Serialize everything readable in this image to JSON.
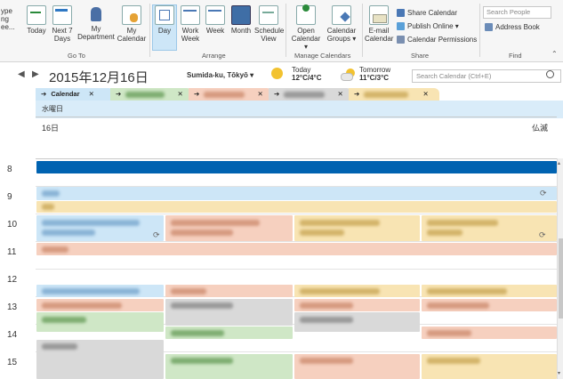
{
  "ribbon": {
    "partial_left": [
      "ype",
      "ng",
      "ee..."
    ],
    "goto": {
      "today": "Today",
      "next7_l1": "Next 7",
      "next7_l2": "Days",
      "dept_l1": "My",
      "dept_l2": "Department",
      "mycal_l1": "My",
      "mycal_l2": "Calendar",
      "group_label": "Go To"
    },
    "arrange": {
      "day": "Day",
      "workweek_l1": "Work",
      "workweek_l2": "Week",
      "week": "Week",
      "month": "Month",
      "schedule_l1": "Schedule",
      "schedule_l2": "View",
      "group_label": "Arrange"
    },
    "manage": {
      "open_l1": "Open",
      "open_l2": "Calendar ▾",
      "groups_l1": "Calendar",
      "groups_l2": "Groups ▾",
      "group_label": "Manage Calendars"
    },
    "share": {
      "email_l1": "E-mail",
      "email_l2": "Calendar",
      "share_calendar": "Share Calendar",
      "publish_online": "Publish Online ▾",
      "permissions": "Calendar Permissions",
      "group_label": "Share"
    },
    "find": {
      "search_people_placeholder": "Search People",
      "address_book": "Address Book",
      "group_label": "Find"
    }
  },
  "nav": {
    "date_title": "2015年12月16日",
    "location": "Sumida-ku, Tōkyō ▾",
    "today_label": "Today",
    "today_temp": "12°C/4°C",
    "tomorrow_label": "Tomorrow",
    "tomorrow_temp": "11°C/3°C",
    "search_placeholder": "Search Calendar (Ctrl+E)"
  },
  "tabs": [
    {
      "label": "Calendar",
      "color": "#cde6f7"
    },
    {
      "label": "",
      "color": "#cfe7c6"
    },
    {
      "label": "",
      "color": "#f6d0bf"
    },
    {
      "label": "",
      "color": "#d9d9d9"
    },
    {
      "label": "",
      "color": "#f8e4b3"
    }
  ],
  "day": {
    "weekday": "水曜日",
    "date": "16日",
    "rokuyo": "仏滅"
  },
  "hours": [
    "8",
    "9",
    "10",
    "11",
    "12",
    "13",
    "14",
    "15"
  ],
  "colors": {
    "accent": "#0063b1",
    "blue": "#cde6f7",
    "green": "#cfe7c6",
    "orange": "#f6d0bf",
    "gray": "#d9d9d9",
    "yellow": "#f8e4b3"
  }
}
